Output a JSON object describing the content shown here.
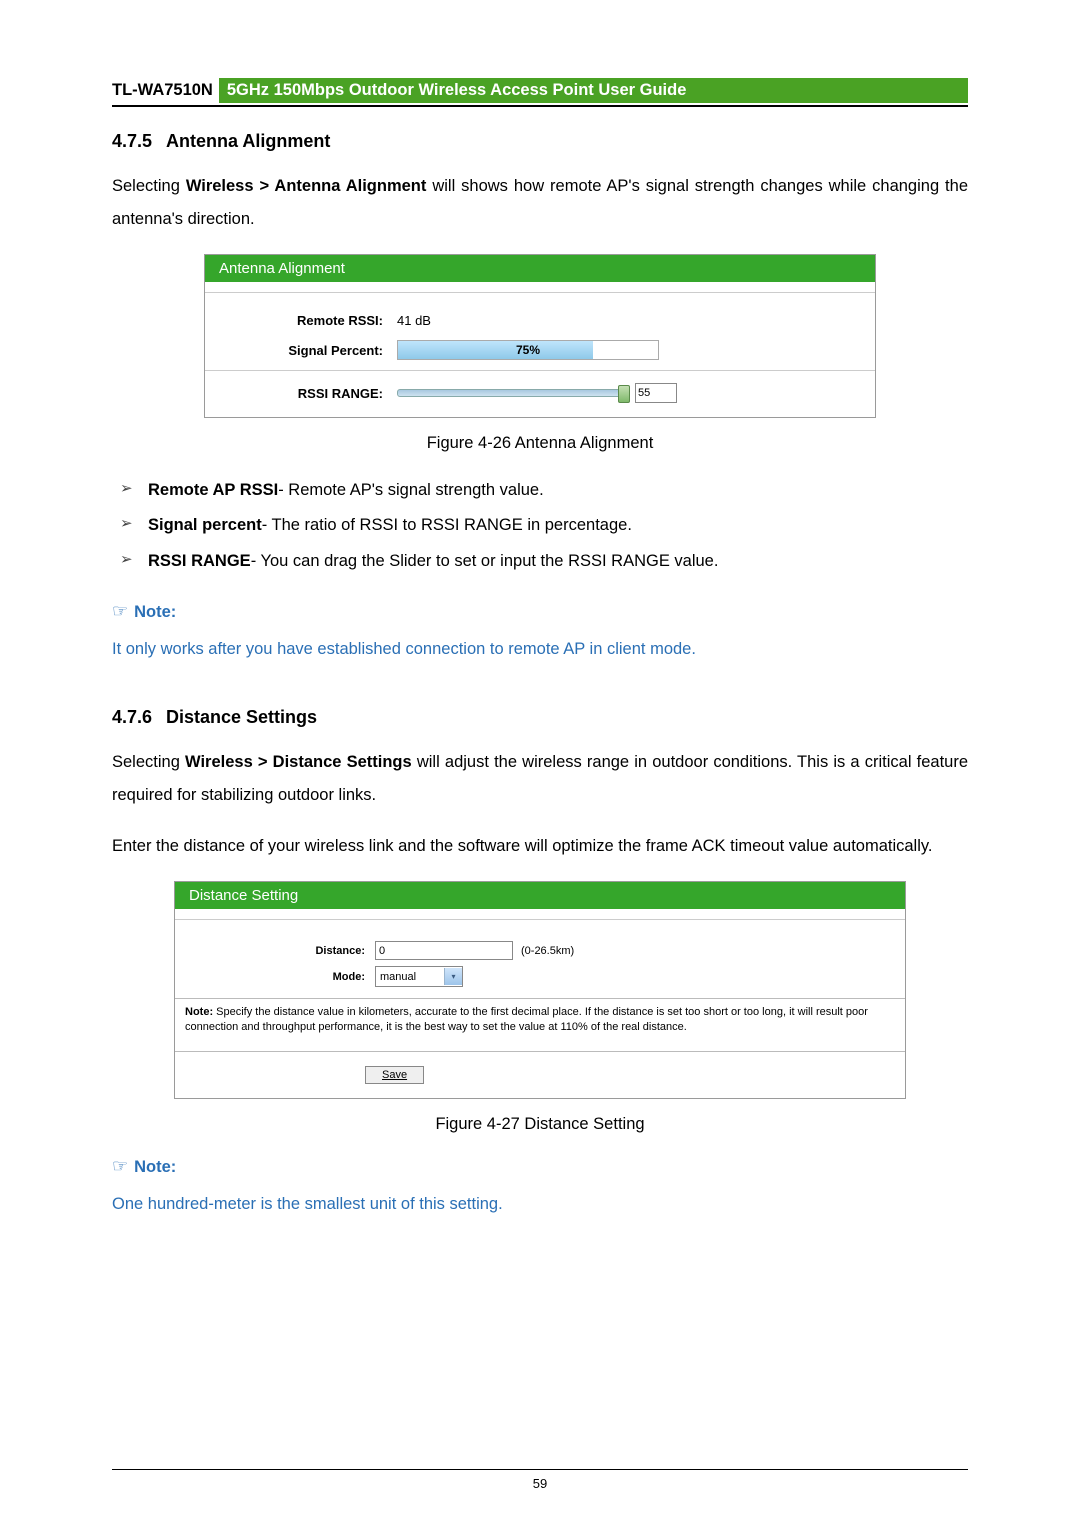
{
  "header": {
    "product": "TL-WA7510N",
    "title": "5GHz 150Mbps Outdoor Wireless Access Point User Guide"
  },
  "sec1": {
    "num": "4.7.5",
    "title": "Antenna Alignment",
    "intro_pre": "Selecting ",
    "intro_bold": "Wireless > Antenna Alignment",
    "intro_post": " will shows how remote AP's signal strength changes while changing the antenna's direction."
  },
  "panel1": {
    "title": "Antenna Alignment",
    "remote_label": "Remote RSSI:",
    "remote_value": "41 dB",
    "signal_label": "Signal Percent:",
    "signal_percent_text": "75%",
    "signal_percent_num": 75,
    "rssi_label": "RSSI RANGE:",
    "rssi_value": "55",
    "slider_pos_percent": 98
  },
  "caption1": "Figure 4-26 Antenna Alignment",
  "bullets": [
    {
      "b": "Remote AP RSSI",
      "t": "- Remote AP's signal strength value."
    },
    {
      "b": "Signal percent",
      "t": "- The ratio of RSSI to RSSI RANGE in percentage."
    },
    {
      "b": "RSSI RANGE",
      "t": "- You can drag the Slider to set or input the RSSI RANGE value."
    }
  ],
  "note1": {
    "heading": "Note:",
    "body": "It only works after you have established connection to remote AP in client mode."
  },
  "sec2": {
    "num": "4.7.6",
    "title": "Distance Settings",
    "p1_pre": "Selecting ",
    "p1_bold": "Wireless > Distance Settings",
    "p1_post": " will adjust the wireless range in outdoor conditions. This is a critical feature required for stabilizing outdoor links.",
    "p2": "Enter the distance of your wireless link and the software will optimize the frame ACK timeout value automatically."
  },
  "panel2": {
    "title": "Distance Setting",
    "distance_label": "Distance:",
    "distance_value": "0",
    "distance_hint": "(0-26.5km)",
    "mode_label": "Mode:",
    "mode_value": "manual",
    "note_bold": "Note:",
    "note_text": " Specify the distance value in kilometers, accurate to the first decimal place. If the distance is set too short or too long, it will result poor connection and throughput performance, it is the best way to set the value at 110% of the real distance.",
    "save": "Save"
  },
  "caption2": "Figure 4-27 Distance Setting",
  "note2": {
    "heading": "Note:",
    "body": "One hundred-meter is the smallest unit of this setting."
  },
  "page_number": "59"
}
